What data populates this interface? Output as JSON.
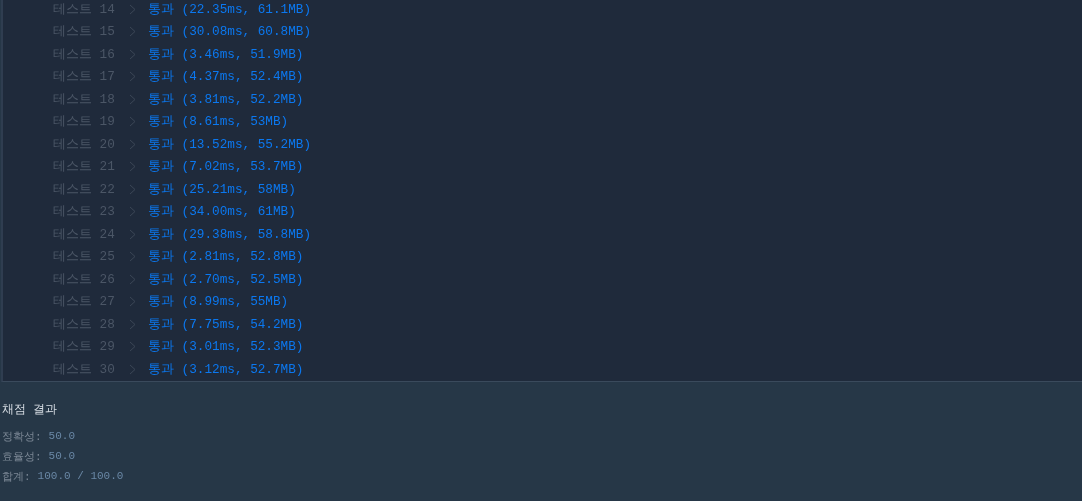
{
  "results": [
    {
      "label": "테스트 14",
      "status": "통과",
      "detail": "(22.35ms, 61.1MB)"
    },
    {
      "label": "테스트 15",
      "status": "통과",
      "detail": "(30.08ms, 60.8MB)"
    },
    {
      "label": "테스트 16",
      "status": "통과",
      "detail": "(3.46ms, 51.9MB)"
    },
    {
      "label": "테스트 17",
      "status": "통과",
      "detail": "(4.37ms, 52.4MB)"
    },
    {
      "label": "테스트 18",
      "status": "통과",
      "detail": "(3.81ms, 52.2MB)"
    },
    {
      "label": "테스트 19",
      "status": "통과",
      "detail": "(8.61ms, 53MB)"
    },
    {
      "label": "테스트 20",
      "status": "통과",
      "detail": "(13.52ms, 55.2MB)"
    },
    {
      "label": "테스트 21",
      "status": "통과",
      "detail": "(7.02ms, 53.7MB)"
    },
    {
      "label": "테스트 22",
      "status": "통과",
      "detail": "(25.21ms, 58MB)"
    },
    {
      "label": "테스트 23",
      "status": "통과",
      "detail": "(34.00ms, 61MB)"
    },
    {
      "label": "테스트 24",
      "status": "통과",
      "detail": "(29.38ms, 58.8MB)"
    },
    {
      "label": "테스트 25",
      "status": "통과",
      "detail": "(2.81ms, 52.8MB)"
    },
    {
      "label": "테스트 26",
      "status": "통과",
      "detail": "(2.70ms, 52.5MB)"
    },
    {
      "label": "테스트 27",
      "status": "통과",
      "detail": "(8.99ms, 55MB)"
    },
    {
      "label": "테스트 28",
      "status": "통과",
      "detail": "(7.75ms, 54.2MB)"
    },
    {
      "label": "테스트 29",
      "status": "통과",
      "detail": "(3.01ms, 52.3MB)"
    },
    {
      "label": "테스트 30",
      "status": "통과",
      "detail": "(3.12ms, 52.7MB)"
    }
  ],
  "summary": {
    "title": "채점 결과",
    "scores": [
      {
        "label": "정확성:",
        "value": "50.0"
      },
      {
        "label": "효율성:",
        "value": "50.0"
      },
      {
        "label": "합계:",
        "value": "100.0 / 100.0"
      }
    ]
  }
}
